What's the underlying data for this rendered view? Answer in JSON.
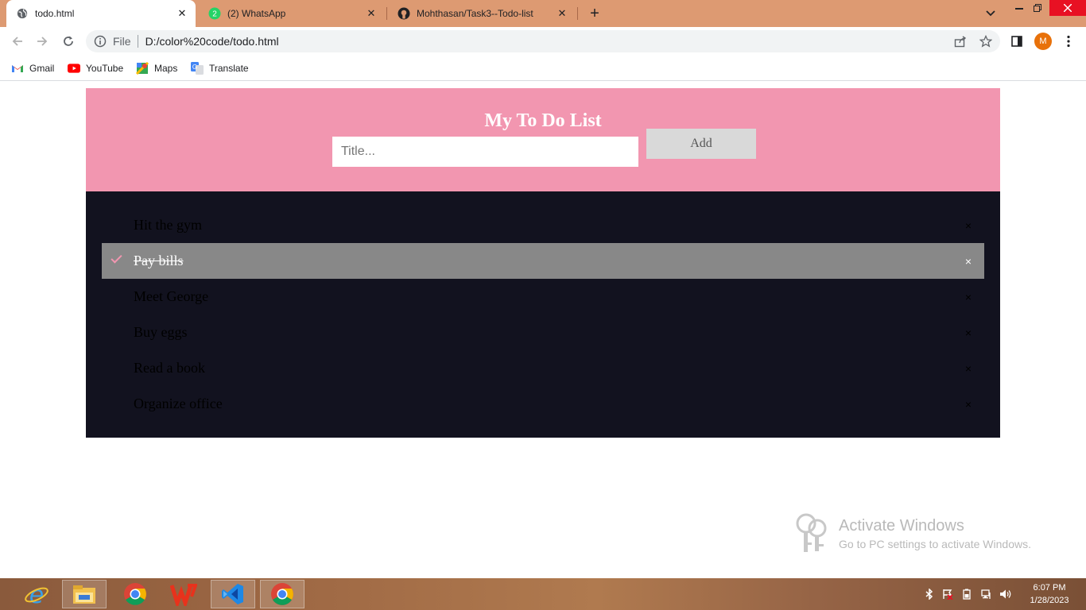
{
  "browser": {
    "tabs": [
      {
        "title": "todo.html",
        "active": true
      },
      {
        "title": "(2) WhatsApp",
        "active": false
      },
      {
        "title": "Mohthasan/Task3--Todo-list",
        "active": false
      }
    ],
    "address": {
      "scheme": "File",
      "url": "D:/color%20code/todo.html"
    },
    "profile_initial": "M",
    "bookmarks": [
      "Gmail",
      "YouTube",
      "Maps",
      "Translate"
    ],
    "colors": {
      "tabstrip": "#dd9a72"
    }
  },
  "app": {
    "heading": "My To Do List",
    "input": {
      "placeholder": "Title...",
      "value": ""
    },
    "add_label": "Add",
    "items": [
      {
        "text": "Hit the gym",
        "checked": false,
        "close": "×"
      },
      {
        "text": "Pay bills",
        "checked": true,
        "close": "×"
      },
      {
        "text": "Meet George",
        "checked": false,
        "close": "×"
      },
      {
        "text": "Buy eggs",
        "checked": false,
        "close": "×"
      },
      {
        "text": "Read a book",
        "checked": false,
        "close": "×"
      },
      {
        "text": "Organize office",
        "checked": false,
        "close": "×"
      }
    ],
    "colors": {
      "header": "#f296b0",
      "list_bg": "#12121f",
      "checked_bg": "#888888"
    }
  },
  "watermark": {
    "title": "Activate Windows",
    "subtitle": "Go to PC settings to activate Windows."
  },
  "taskbar": {
    "apps": [
      "internet-explorer",
      "file-explorer",
      "chrome",
      "wps-office",
      "vscode",
      "chrome-active"
    ],
    "time": "6:07 PM",
    "date": "1/28/2023"
  }
}
